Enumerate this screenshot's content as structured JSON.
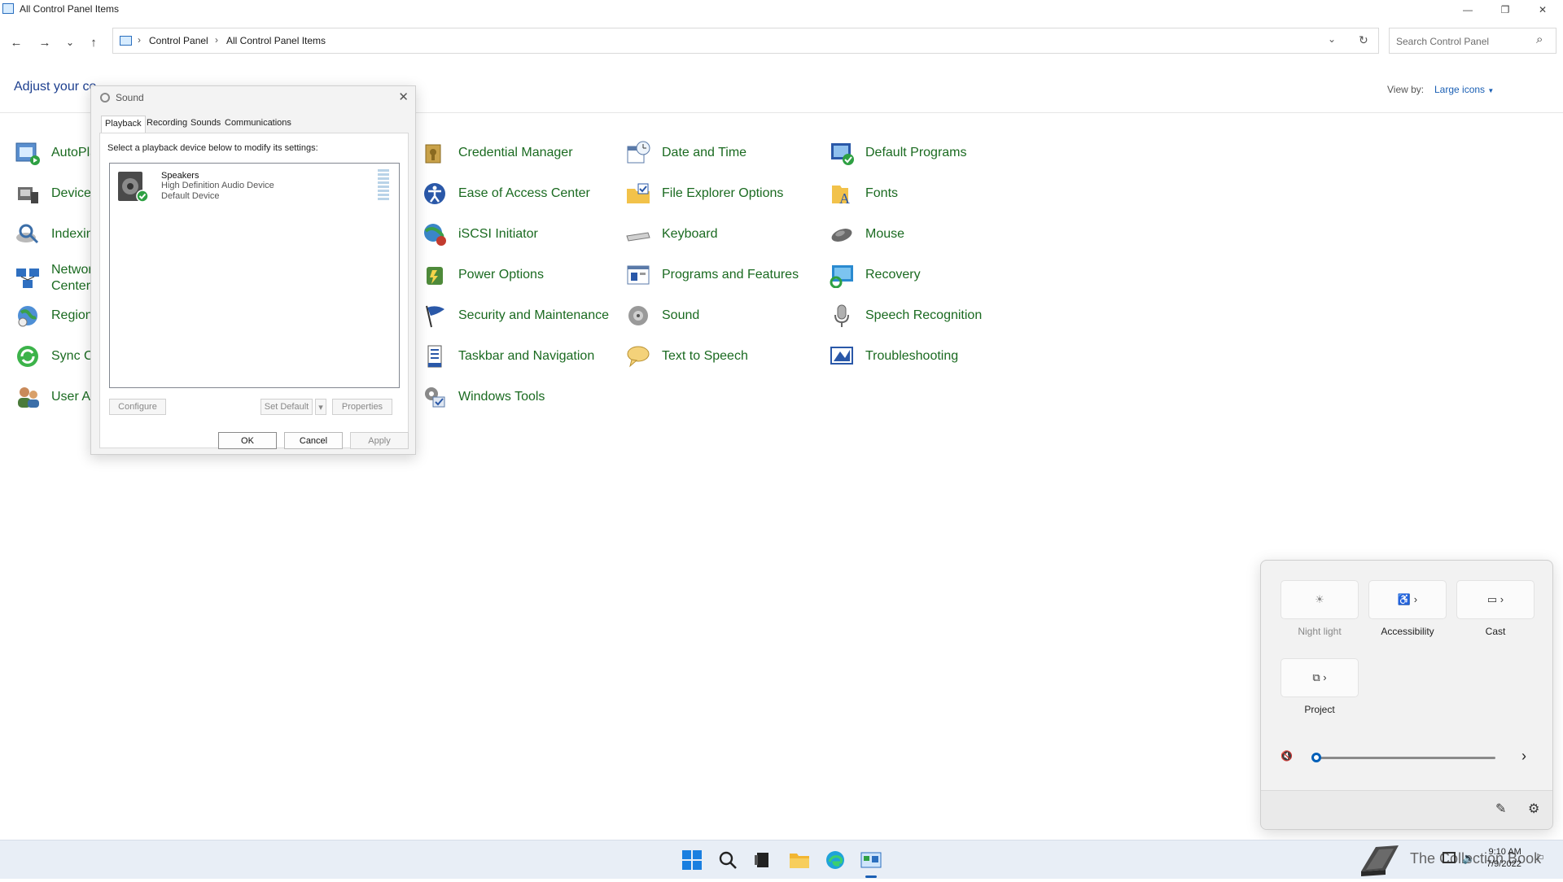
{
  "window": {
    "title": "All Control Panel Items",
    "minimize_glyph": "—",
    "restore_glyph": "❐",
    "close_glyph": "✕"
  },
  "nav": {
    "back_glyph": "←",
    "forward_glyph": "→",
    "recent_glyph": "⌄",
    "up_glyph": "↑",
    "crumbs": [
      "Control Panel",
      "All Control Panel Items"
    ],
    "separator": "›",
    "refresh_glyph": "↻",
    "dropdown_glyph": "⌄",
    "search_placeholder": "Search Control Panel",
    "search_glyph": "⌕"
  },
  "header": {
    "adjust_text": "Adjust your co",
    "view_by_label": "View by:",
    "view_by_value": "Large icons",
    "view_caret": "▼"
  },
  "items": {
    "col0": [
      "AutoPla",
      "Device",
      "Indexin",
      "Networ",
      "Region",
      "Sync Ce",
      "User Ac"
    ],
    "network_line2": "Center",
    "col1": [
      "Credential Manager",
      "Ease of Access Center",
      "iSCSI Initiator",
      "Power Options",
      "Security and Maintenance",
      "Taskbar and Navigation",
      "Windows Tools"
    ],
    "col2": [
      "Date and Time",
      "File Explorer Options",
      "Keyboard",
      "Programs and Features",
      "Sound",
      "Text to Speech"
    ],
    "col3": [
      "Default Programs",
      "Fonts",
      "Mouse",
      "Recovery",
      "Speech Recognition",
      "Troubleshooting"
    ]
  },
  "dialog": {
    "title": "Sound",
    "close_glyph": "✕",
    "tabs": [
      "Playback",
      "Recording",
      "Sounds",
      "Communications"
    ],
    "instruction": "Select a playback device below to modify its settings:",
    "device": {
      "name": "Speakers",
      "description": "High Definition Audio Device",
      "status": "Default Device"
    },
    "buttons": {
      "configure": "Configure",
      "set_default": "Set Default",
      "set_default_arrow": "▾",
      "properties": "Properties",
      "ok": "OK",
      "cancel": "Cancel",
      "apply": "Apply"
    }
  },
  "quick_settings": {
    "tiles": [
      {
        "label": "Night light",
        "glyph": "☀"
      },
      {
        "label": "Accessibility",
        "glyph": "♿ ›"
      },
      {
        "label": "Cast",
        "glyph": "▭ ›"
      },
      {
        "label": "Project",
        "glyph": "⧉ ›"
      }
    ],
    "volume_icon": "🔇",
    "volume_level": 0,
    "volume_more": "›",
    "edit_glyph": "✎",
    "settings_glyph": "⚙"
  },
  "taskbar": {
    "watermark": "The Collection Book",
    "time": "9:10 AM",
    "date": "7/9/2022"
  }
}
